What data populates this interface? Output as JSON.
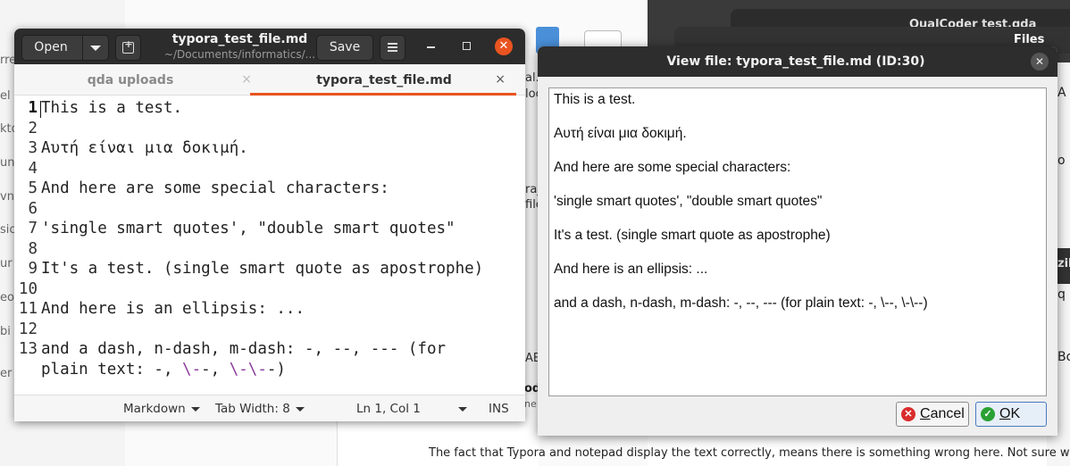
{
  "background": {
    "left_fragments": [
      "rre",
      "el",
      "kto",
      "un",
      "vnl",
      "sic",
      "ur",
      "eo",
      "bi",
      "er"
    ],
    "right_window_title": "QualCoder test.qda",
    "files_window_title": "Files",
    "right_fragments": [
      "A",
      "o",
      "zil",
      "q",
      "Bo"
    ],
    "mid_fragments": [
      "al.",
      "loc",
      "ra_",
      "file",
      "od",
      "ne",
      "AE"
    ],
    "bottom_text": "The fact that Typora and notepad display the text correctly, means there is something wrong here. Not sure what Typ"
  },
  "gedit": {
    "open_label": "Open",
    "title": "typora_test_file.md",
    "subtitle": "~/Documents/informatics/...",
    "save_label": "Save",
    "close_glyph": "✕",
    "tabs": [
      {
        "label": "qda uploads",
        "close": "×"
      },
      {
        "label": "typora_test_file.md",
        "close": "×"
      }
    ],
    "lines": [
      {
        "n": "1",
        "text": "This is a test."
      },
      {
        "n": "2",
        "text": ""
      },
      {
        "n": "3",
        "text": "Αυτή είναι μια δοκιμή."
      },
      {
        "n": "4",
        "text": ""
      },
      {
        "n": "5",
        "text": "And here are some special characters:"
      },
      {
        "n": "6",
        "text": ""
      },
      {
        "n": "7",
        "text": "'single smart quotes', \"double smart quotes\""
      },
      {
        "n": "8",
        "text": ""
      },
      {
        "n": "9",
        "text": "It's a test. (single smart quote as apostrophe)"
      },
      {
        "n": "10",
        "text": ""
      },
      {
        "n": "11",
        "text": "And here is an ellipsis: ..."
      },
      {
        "n": "12",
        "text": ""
      },
      {
        "n": "13",
        "text": "and a dash, n-dash, m-dash: -, --, --- (for"
      }
    ],
    "line13_cont": {
      "a": "plain text: -, ",
      "b": "\\-",
      "c": "-, ",
      "d": "\\-\\-",
      "e": "-)"
    },
    "status": {
      "language": "Markdown",
      "tab_width": "Tab Width: 8",
      "position": "Ln 1, Col 1",
      "mode": "INS"
    }
  },
  "dialog": {
    "title": "View file: typora_test_file.md (ID:30)",
    "close_glyph": "✕",
    "paragraphs": [
      "This is a test.",
      "Αυτή είναι μια δοκιμή.",
      "And here are some special characters:",
      "'single smart quotes', \"double smart quotes\"",
      "It's a test. (single smart quote as apostrophe)",
      "And here is an ellipsis: ...",
      "and a dash, n-dash, m-dash: -, --, --- (for plain text: -, \\--, \\-\\--)"
    ],
    "cancel_label_u": "C",
    "cancel_label_rest": "ancel",
    "ok_label_u": "O",
    "ok_label_rest": "K",
    "cancel_icon": "✕",
    "ok_icon": "✓"
  }
}
